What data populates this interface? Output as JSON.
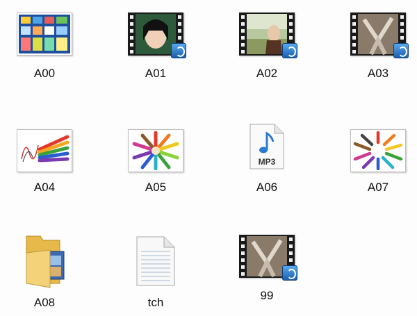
{
  "window": {
    "view": "large-icons"
  },
  "items": [
    {
      "id": "A00",
      "label": "A00",
      "kind": "image",
      "icon": "image-collage-icon"
    },
    {
      "id": "A01",
      "label": "A01",
      "kind": "video",
      "icon": "video-file-icon"
    },
    {
      "id": "A02",
      "label": "A02",
      "kind": "video",
      "icon": "video-file-icon"
    },
    {
      "id": "A03",
      "label": "A03",
      "kind": "video",
      "icon": "video-file-icon"
    },
    {
      "id": "A04",
      "label": "A04",
      "kind": "image",
      "icon": "pencils-sketch-icon"
    },
    {
      "id": "A05",
      "label": "A05",
      "kind": "image",
      "icon": "pencils-circle-icon"
    },
    {
      "id": "A06",
      "label": "A06",
      "kind": "audio",
      "icon": "mp3-file-icon",
      "badge_text": "MP3"
    },
    {
      "id": "A07",
      "label": "A07",
      "kind": "image",
      "icon": "pencils-ring-icon"
    },
    {
      "id": "A08",
      "label": "A08",
      "kind": "folder",
      "icon": "folder-icon"
    },
    {
      "id": "tch",
      "label": "tch",
      "kind": "text",
      "icon": "text-document-icon"
    },
    {
      "id": "99",
      "label": "99",
      "kind": "video",
      "icon": "video-file-icon"
    }
  ],
  "colors": {
    "background": "#fdfdfd",
    "label_text": "#111111",
    "film_strip": "#1a1a1a",
    "badge_blue": "#1b5fb0",
    "folder_yellow": "#f3d27a"
  }
}
